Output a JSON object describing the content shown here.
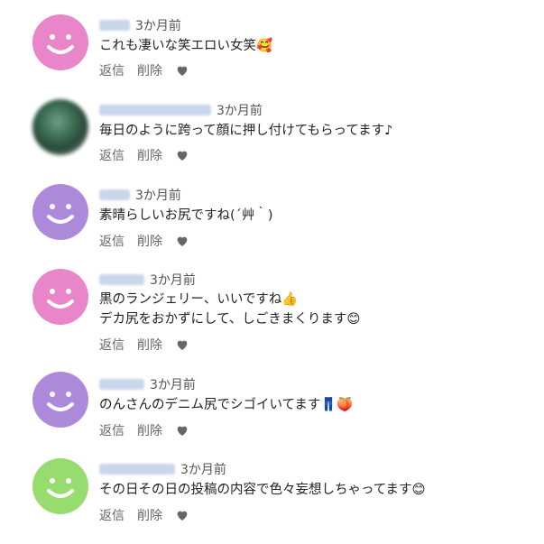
{
  "colors": {
    "pink": "#e985c9",
    "purple": "#ad8ad9",
    "green": "#97dc6e"
  },
  "comments": [
    {
      "time": "3か月前",
      "text": "これも凄いな笑エロい女笑🥰",
      "reply": "返信",
      "delete": "削除",
      "avatar_icon": "smiley-face-icon"
    },
    {
      "time": "3か月前",
      "text": "毎日のように跨って顔に押し付けてもらってます♪",
      "reply": "返信",
      "delete": "削除",
      "avatar_icon": "blurred-photo"
    },
    {
      "time": "3か月前",
      "text": "素晴らしいお尻ですね(´艸｀)",
      "reply": "返信",
      "delete": "削除",
      "avatar_icon": "smiley-face-icon"
    },
    {
      "time": "3か月前",
      "text_line1": "黒のランジェリー、いいですね👍",
      "text_line2": "デカ尻をおかずにして、しごきまくります😊",
      "reply": "返信",
      "delete": "削除",
      "avatar_icon": "smiley-face-icon"
    },
    {
      "time": "3か月前",
      "text": "のんさんのデニム尻でシゴイいてます👖🍑",
      "reply": "返信",
      "delete": "削除",
      "avatar_icon": "smiley-face-icon"
    },
    {
      "time": "3か月前",
      "text": "その日その日の投稿の内容で色々妄想しちゃってます😊",
      "reply": "返信",
      "delete": "削除",
      "avatar_icon": "smiley-face-icon"
    }
  ]
}
